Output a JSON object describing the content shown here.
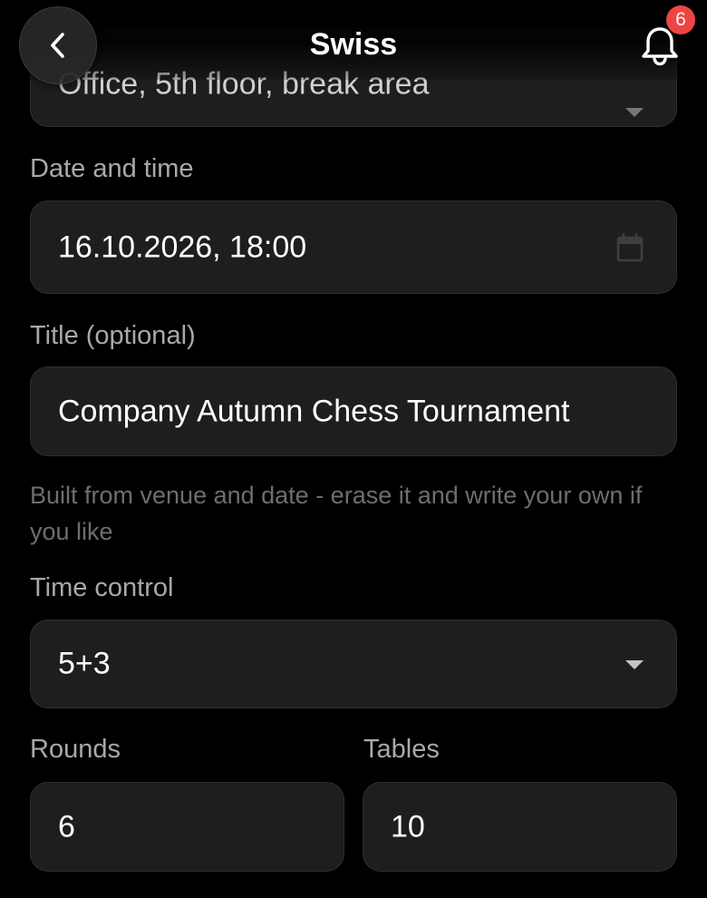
{
  "header": {
    "title": "Swiss",
    "notification_count": "6"
  },
  "form": {
    "venue": {
      "value": "Office, 5th floor, break area"
    },
    "date_time": {
      "label": "Date and time",
      "value": "16.10.2026, 18:00"
    },
    "title": {
      "label": "Title (optional)",
      "value": "Company Autumn Chess Tournament",
      "hint": "Built from venue and date - erase it and write your own if you like"
    },
    "time_control": {
      "label": "Time control",
      "value": "5+3"
    },
    "rounds": {
      "label": "Rounds",
      "value": "6"
    },
    "tables": {
      "label": "Tables",
      "value": "10"
    }
  },
  "icons": {
    "back": "chevron-left-icon",
    "notifications": "bell-icon",
    "calendar": "calendar-icon",
    "dropdown": "caret-down-icon"
  },
  "colors": {
    "background": "#000000",
    "field_background": "#1e1e1e",
    "label": "#a9a9a9",
    "hint": "#6e6e6e",
    "badge": "#ef4444"
  }
}
